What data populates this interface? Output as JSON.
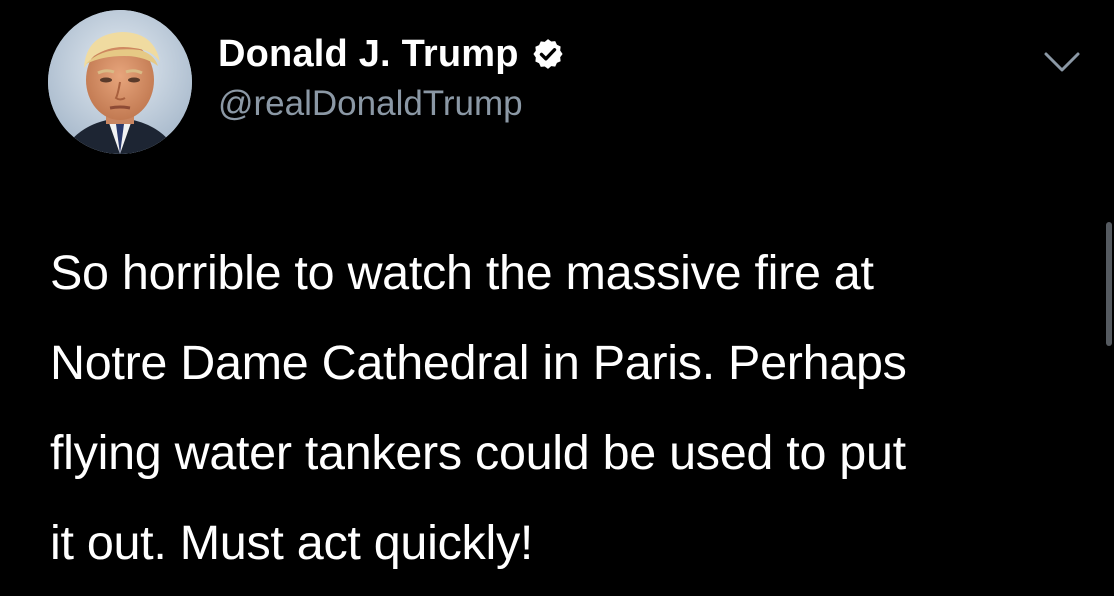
{
  "author": {
    "display_name": "Donald J. Trump",
    "handle": "@realDonaldTrump",
    "verified": true,
    "avatar_icon": "profile-photo",
    "verified_icon": "verified-badge-icon"
  },
  "menu": {
    "icon": "chevron-down-icon"
  },
  "tweet": {
    "lines": [
      "So horrible to watch the massive fire at",
      "Notre Dame Cathedral in Paris. Perhaps",
      "flying water tankers could be used to put",
      "it out. Must act quickly!"
    ]
  },
  "colors": {
    "background": "#000000",
    "text": "#ffffff",
    "handle": "#8b98a5",
    "chevron": "#8b98a5"
  }
}
